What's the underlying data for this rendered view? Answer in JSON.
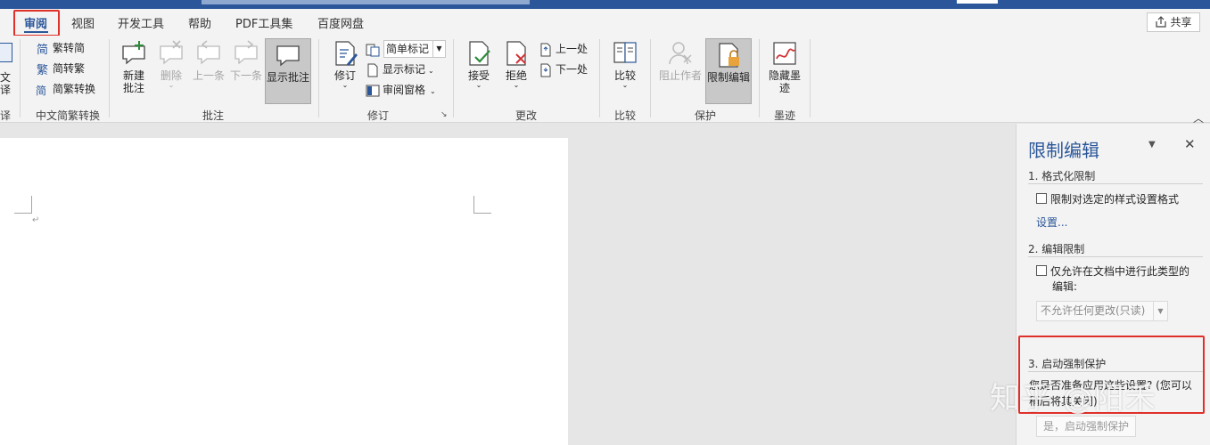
{
  "tabs": [
    {
      "label": "审阅",
      "active": true
    },
    {
      "label": "视图"
    },
    {
      "label": "开发工具"
    },
    {
      "label": "帮助"
    },
    {
      "label": "PDF工具集"
    },
    {
      "label": "百度网盘"
    }
  ],
  "share_label": "共享",
  "ribbon": {
    "partial_left": {
      "label_line1": "文",
      "label_line2": "译",
      "group_label": "译"
    },
    "chinese_convert": {
      "group_label": "中文简繁转换",
      "items": [
        "繁转简",
        "简转繁",
        "简繁转换"
      ]
    },
    "comments": {
      "group_label": "批注",
      "new_comment_line1": "新建",
      "new_comment_line2": "批注",
      "delete": "删除",
      "previous": "上一条",
      "next": "下一条",
      "show_comments": "显示批注"
    },
    "tracking": {
      "group_label": "修订",
      "track_changes": "修订",
      "markup_select": "简单标记",
      "show_markup": "显示标记",
      "reviewing_pane": "审阅窗格"
    },
    "changes": {
      "group_label": "更改",
      "accept": "接受",
      "reject": "拒绝",
      "previous": "上一处",
      "next": "下一处"
    },
    "compare": {
      "group_label": "比较",
      "compare": "比较"
    },
    "protect": {
      "group_label": "保护",
      "block_authors": "阻止作者",
      "restrict_editing": "限制编辑"
    },
    "ink": {
      "group_label": "墨迹",
      "hide_ink_line1": "隐藏墨",
      "hide_ink_line2": "迹"
    }
  },
  "pane": {
    "title": "限制编辑",
    "section1_title": "1. 格式化限制",
    "section1_checkbox": "限制对选定的样式设置格式",
    "section1_link": "设置...",
    "section2_title": "2. 编辑限制",
    "section2_checkbox_line1": "仅允许在文档中进行此类型的",
    "section2_checkbox_line2": "编辑:",
    "section2_select": "不允许任何更改(只读)",
    "section3_title": "3. 启动强制保护",
    "section3_text_line1": "您是否准备应用这些设置? (您可以",
    "section3_text_line2": "稍后将其关闭)",
    "section3_button": "是，启动强制保护"
  },
  "watermark": "知乎 @阳禾",
  "colors": {
    "accent": "#2b579a",
    "highlight_red": "#e0302a",
    "ribbon_bg": "#f3f3f3",
    "canvas_bg": "#e6e6e6"
  }
}
